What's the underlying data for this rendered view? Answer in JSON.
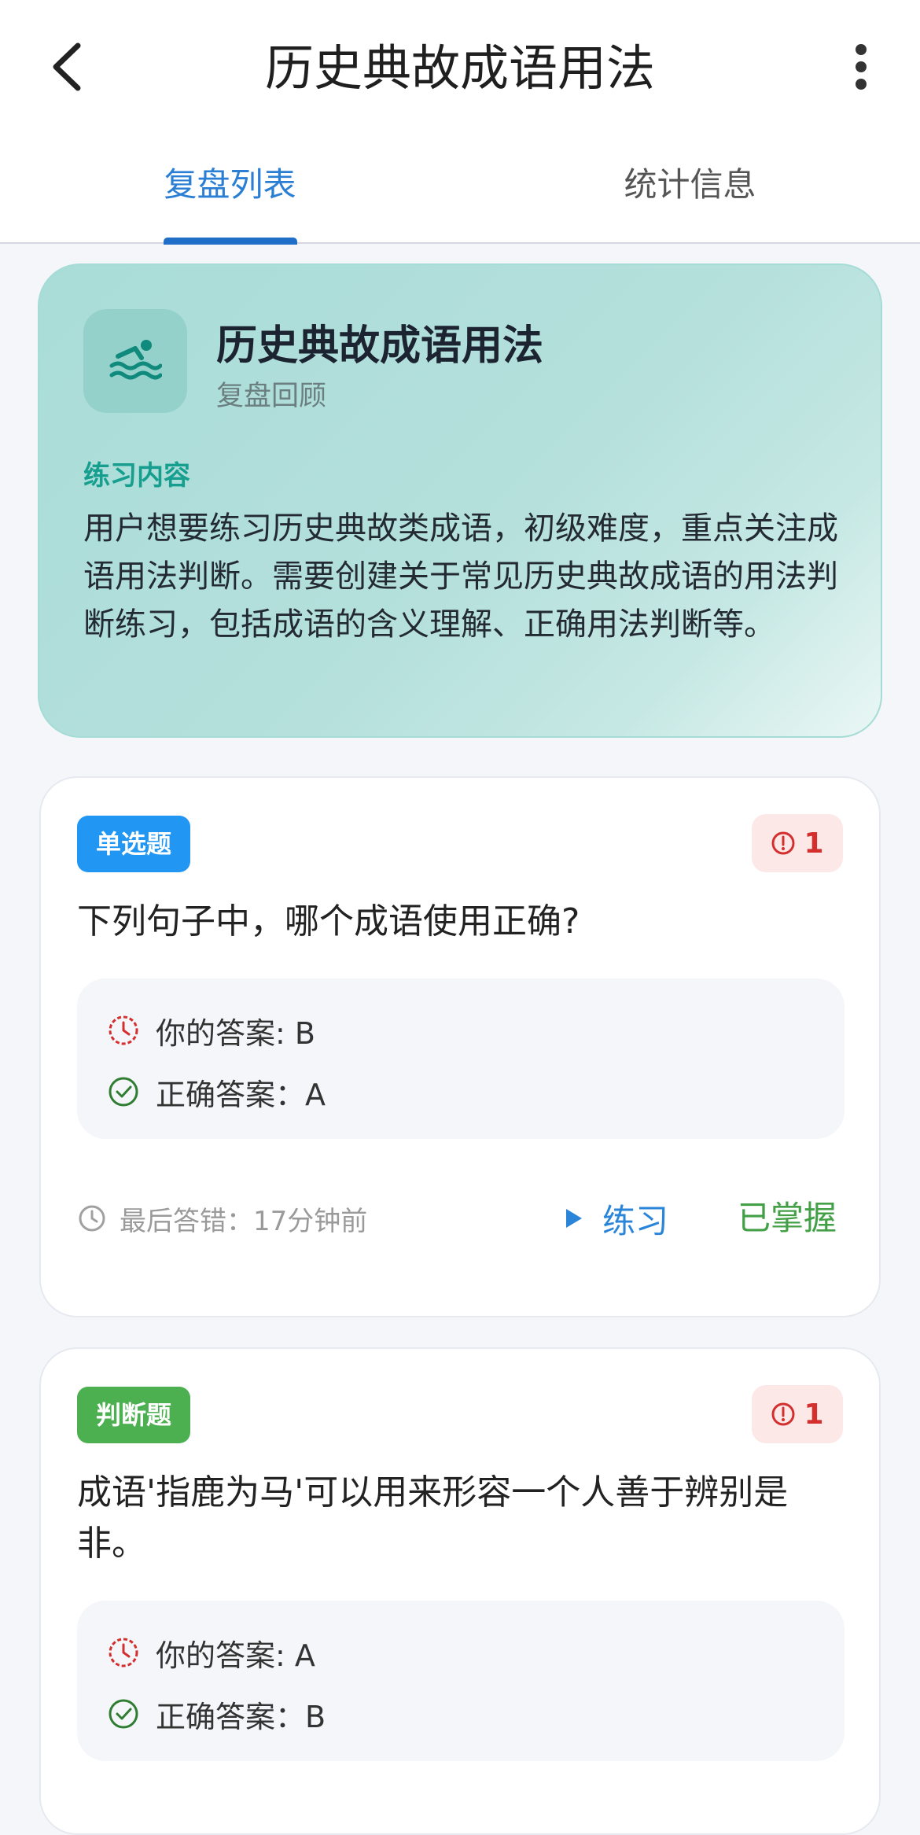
{
  "header": {
    "title": "历史典故成语用法",
    "back_icon": "chevron-left-icon",
    "more_icon": "more-vertical-icon"
  },
  "tabs": [
    {
      "label": "复盘列表",
      "active": true
    },
    {
      "label": "统计信息",
      "active": false
    }
  ],
  "summary": {
    "icon": "swimming-icon",
    "title": "历史典故成语用法",
    "subtitle": "复盘回顾",
    "section_label": "练习内容",
    "description": "用户想要练习历史典故类成语，初级难度，重点关注成语用法判断。需要创建关于常见历史典故成语的用法判断练习，包括成语的含义理解、正确用法判断等。"
  },
  "questions": [
    {
      "type": "单选题",
      "error_count": "1",
      "text": "下列句子中，哪个成语使用正确?",
      "your_answer": "你的答案: B",
      "correct_answer": "正确答案：A",
      "last_wrong": "最后答错：17分钟前",
      "practice_label": "练习",
      "mastered_label": "已掌握"
    },
    {
      "type": "判断题",
      "error_count": "1",
      "text": "成语'指鹿为马'可以用来形容一个人善于辨别是非。",
      "your_answer": "你的答案: A",
      "correct_answer": "正确答案：B"
    }
  ],
  "colors": {
    "accent_blue": "#2196f3",
    "accent_green": "#4caf50",
    "error_red": "#d32f2f",
    "teal": "#169e8e"
  }
}
